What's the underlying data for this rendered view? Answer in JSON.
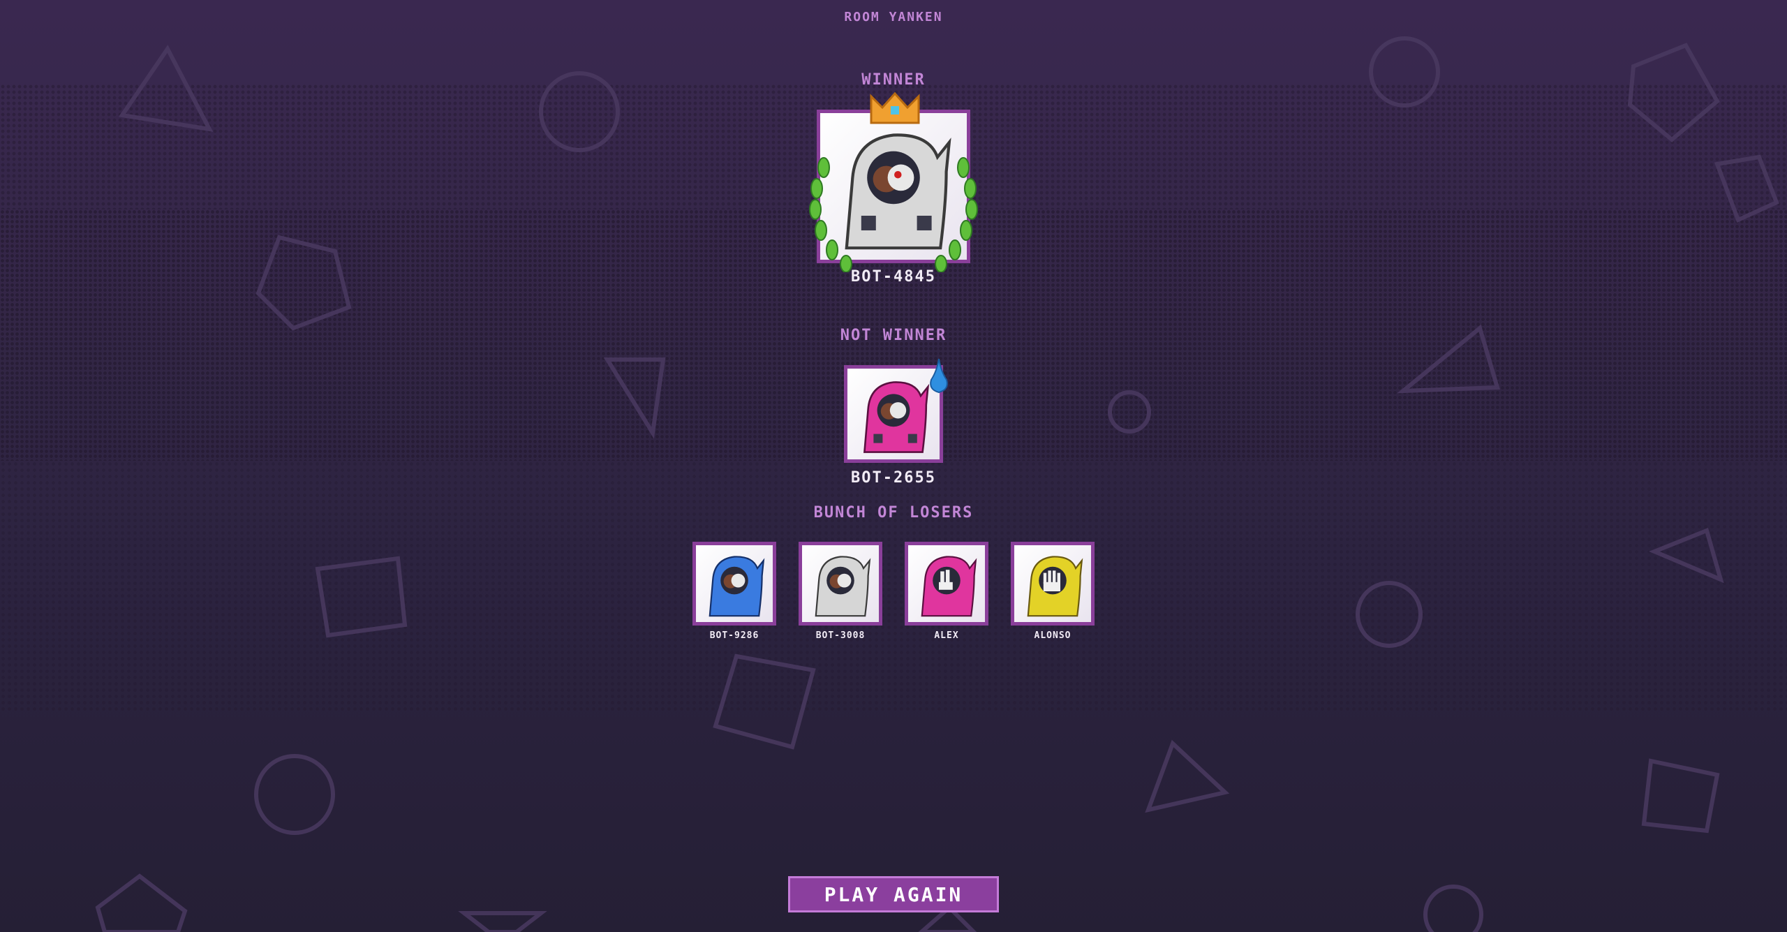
{
  "room": {
    "title": "ROOM YANKEN"
  },
  "sections": {
    "winner_label": "WINNER",
    "not_winner_label": "NOT WINNER",
    "losers_label": "BUNCH OF LOSERS"
  },
  "winner": {
    "name": "BOT-4845",
    "hood_color": "#d8d8d8",
    "badge": "crown-icon"
  },
  "not_winner": {
    "name": "BOT-2655",
    "hood_color": "#e0359e",
    "badge": "sweat-drop-icon"
  },
  "losers": [
    {
      "name": "BOT-9286",
      "hood_color": "#3a7be0"
    },
    {
      "name": "BOT-3008",
      "hood_color": "#d6d6d6"
    },
    {
      "name": "ALEX",
      "hood_color": "#e0359e"
    },
    {
      "name": "ALONSO",
      "hood_color": "#e3d227"
    }
  ],
  "actions": {
    "play_again_label": "PLAY AGAIN"
  },
  "colors": {
    "accent": "#8b3f9e",
    "label": "#c286d6",
    "background": "#2c2340",
    "laurel": "#5fbf3a",
    "crown": "#f0a030"
  }
}
